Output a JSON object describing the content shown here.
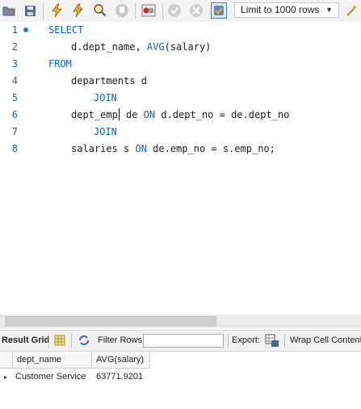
{
  "toolbar": {
    "limit_label": "Limit to 1000 rows",
    "icons": [
      "open-folder-icon",
      "save-icon",
      "execute-icon",
      "execute-current-icon",
      "explain-icon",
      "stop-icon",
      "toggle-error-icon",
      "commit-icon",
      "rollback-icon",
      "autocommit-icon",
      "dropdown-icon",
      "beautify-icon"
    ]
  },
  "editor": {
    "lines": [
      {
        "n": "1",
        "segments": [
          {
            "t": "SELECT",
            "kw": true
          }
        ]
      },
      {
        "n": "2",
        "segments": [
          {
            "t": "d.dept_name, ",
            "kw": false
          },
          {
            "t": "AVG",
            "kw": true
          },
          {
            "t": "(salary)",
            "kw": false
          }
        ]
      },
      {
        "n": "3",
        "segments": [
          {
            "t": "FROM",
            "kw": true
          }
        ]
      },
      {
        "n": "4",
        "segments": [
          {
            "t": "departments d",
            "kw": false
          }
        ]
      },
      {
        "n": "5",
        "segments": [
          {
            "t": "JOIN",
            "kw": true
          }
        ]
      },
      {
        "n": "6",
        "segments": [
          {
            "t": "dept_emp",
            "kw": false
          },
          {
            "t": " de ",
            "kw": false
          },
          {
            "t": "ON",
            "kw": true
          },
          {
            "t": " d.dept_no = de.dept_no",
            "kw": false
          }
        ]
      },
      {
        "n": "7",
        "segments": [
          {
            "t": "JOIN",
            "kw": true
          }
        ]
      },
      {
        "n": "8",
        "segments": [
          {
            "t": "salaries s ",
            "kw": false
          },
          {
            "t": "ON",
            "kw": true
          },
          {
            "t": " de.emp_no = s.emp_no;",
            "kw": false
          }
        ]
      }
    ]
  },
  "result_toolbar": {
    "result_grid_label": "Result Grid",
    "filter_rows_label": "Filter Rows:",
    "filter_value": "",
    "export_label": "Export:",
    "wrap_label": "Wrap Cell Content:"
  },
  "grid": {
    "columns": [
      "dept_name",
      "AVG(salary)"
    ],
    "rows": [
      [
        "Customer Service",
        "63771.9201"
      ]
    ]
  },
  "colors": {
    "keyword": "#0a62c9",
    "line_number": "#2a5db0"
  }
}
